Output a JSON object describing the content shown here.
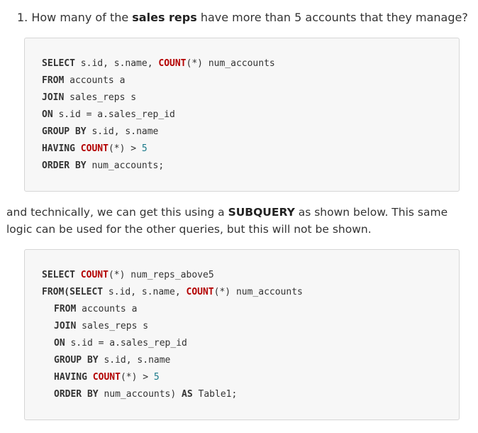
{
  "question": {
    "prefix": "1. How many of the ",
    "bold": "sales reps",
    "suffix": " have more than 5 accounts that they manage?"
  },
  "query1": {
    "l1": {
      "kw": "SELECT",
      "a": " s.id, s.name, ",
      "fn": "COUNT",
      "b": "(*) num_accounts"
    },
    "l2": {
      "kw": "FROM",
      "a": " accounts a"
    },
    "l3": {
      "kw": "JOIN",
      "a": " sales_reps s"
    },
    "l4": {
      "kw": "ON",
      "a": " s.id = a.sales_rep_id"
    },
    "l5": {
      "kw": "GROUP BY",
      "a": " s.id, s.name"
    },
    "l6": {
      "kw": "HAVING",
      "sp": " ",
      "fn": "COUNT",
      "a": "(*) > ",
      "num": "5"
    },
    "l7": {
      "kw": "ORDER BY",
      "a": " num_accounts;"
    }
  },
  "paragraph": {
    "prefix": "and technically, we can get this using a ",
    "bold": "SUBQUERY",
    "suffix": " as shown below. This same logic can be used for the other queries, but this will not be shown."
  },
  "query2": {
    "l1": {
      "kw": "SELECT",
      "sp": " ",
      "fn": "COUNT",
      "a": "(*) num_reps_above5"
    },
    "l2": {
      "kw": "FROM(SELECT",
      "a": " s.id, s.name, ",
      "fn": "COUNT",
      "b": "(*) num_accounts"
    },
    "l3": {
      "kw": "FROM",
      "a": " accounts a"
    },
    "l4": {
      "kw": "JOIN",
      "a": " sales_reps s"
    },
    "l5": {
      "kw": "ON",
      "a": " s.id = a.sales_rep_id"
    },
    "l6": {
      "kw": "GROUP BY",
      "a": " s.id, s.name"
    },
    "l7": {
      "kw": "HAVING",
      "sp": " ",
      "fn": "COUNT",
      "a": "(*) > ",
      "num": "5"
    },
    "l8": {
      "kw": "ORDER BY",
      "a": " num_accounts) ",
      "kw2": "AS",
      "b": " Table1;"
    }
  }
}
